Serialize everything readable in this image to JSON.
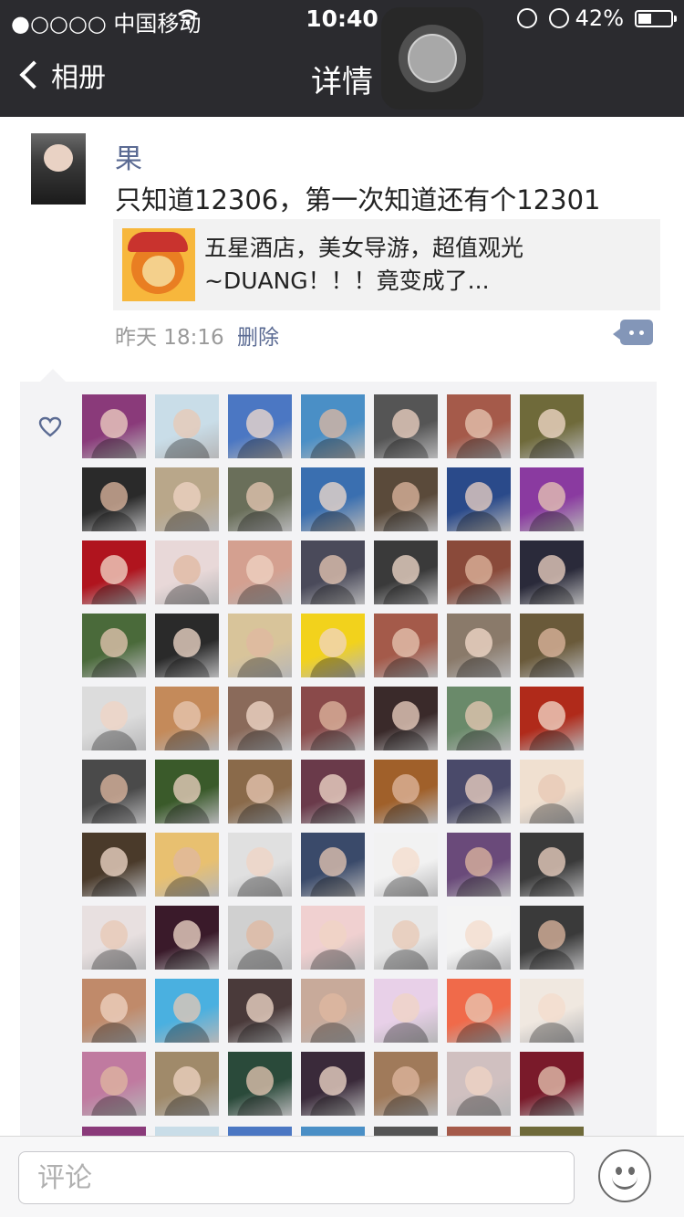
{
  "status_bar": {
    "carrier": "●○○○○ 中国移动",
    "time": "10:40",
    "battery_percent": "42%",
    "battery_level": 0.42
  },
  "nav": {
    "back_label": "相册",
    "title": "详情"
  },
  "post": {
    "author": "果",
    "text": "只知道12306，第一次知道还有个12301",
    "share_title": "五星酒店，美女导游，超值观光~DUANG！！！竟变成了...",
    "time": "昨天 18:16",
    "delete_label": "删除"
  },
  "likes": {
    "icon": "heart-icon",
    "avatar_count": 70,
    "colors": [
      "#8a3a7a",
      "#c9dde8",
      "#4b77c3",
      "#4a8fc6",
      "#555555",
      "#a55a4a",
      "#6f6a3a",
      "#2a2a2a",
      "#b9a78a",
      "#6a6f5a",
      "#3a6fb0",
      "#5a4a3a",
      "#2a4a8a",
      "#8a3aa0",
      "#b0141e",
      "#e8d8d8",
      "#d4a090",
      "#4a4a5a",
      "#3a3a3a",
      "#8a4a3a",
      "#2a2a3a",
      "#4a6a3a",
      "#2a2a2a",
      "#d8c49a",
      "#f2d21c",
      "#a45a4a",
      "#8a7a6a",
      "#6a5a3a",
      "#dcdcdc",
      "#c48a5a",
      "#8a6a5a",
      "#8a4a4a",
      "#3a2a2a",
      "#6a8a6a",
      "#b02a1a",
      "#4a4a4a",
      "#3a5a2a",
      "#8a6a4a",
      "#6a3a4a",
      "#a0602a",
      "#4a4a6a",
      "#f0e0d0",
      "#4a3a2a",
      "#e8c070",
      "#e0e0e0",
      "#3a4a6a",
      "#f2f2f2",
      "#6a4a7a",
      "#3a3a3a",
      "#e8e0e0",
      "#3a1a2a",
      "#d0d0d0",
      "#f0d0d0",
      "#e8e8e8",
      "#f4f4f4",
      "#3a3a3a",
      "#c08a6a",
      "#4ab0e0",
      "#4a3a3a",
      "#c8aa9a",
      "#e8d0e8",
      "#f06a4a",
      "#f0e8e0",
      "#c07aa0",
      "#a08a6a",
      "#2a4a3a",
      "#3a2a3a",
      "#a07a5a",
      "#d0c0c0",
      "#7a1a2a"
    ]
  },
  "comment_bar": {
    "placeholder": "评论",
    "emoji_icon": "smile-icon"
  }
}
